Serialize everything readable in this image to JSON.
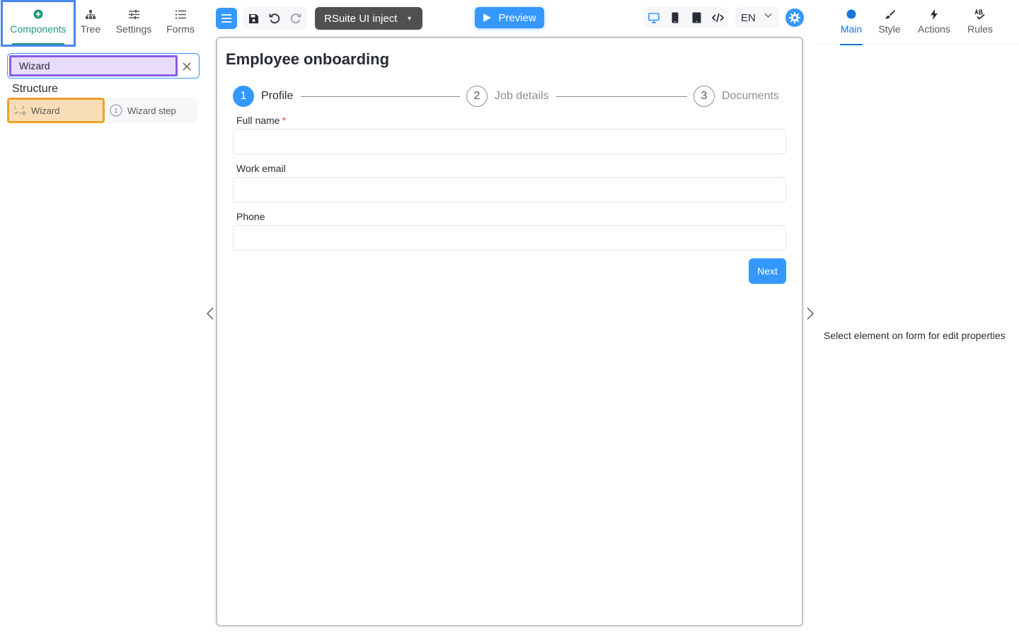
{
  "left_tabs": [
    {
      "label": "Components",
      "icon": "plus-circle-icon",
      "active": true
    },
    {
      "label": "Tree",
      "icon": "sitemap-icon"
    },
    {
      "label": "Settings",
      "icon": "sliders-icon"
    },
    {
      "label": "Forms",
      "icon": "list-icon"
    }
  ],
  "search": {
    "value": "Wizard",
    "placeholder": "Search"
  },
  "palette": {
    "section_title": "Structure",
    "items": [
      {
        "label": "Wizard",
        "icon": "wizard-icon"
      },
      {
        "label": "Wizard step",
        "icon": "step-number-icon",
        "icon_text": "1"
      }
    ]
  },
  "toolbar": {
    "theme": "RSuite UI inject",
    "preview_label": "Preview",
    "language": "EN"
  },
  "form": {
    "title": "Employee onboarding",
    "steps": [
      {
        "number": "1",
        "label": "Profile",
        "active": true
      },
      {
        "number": "2",
        "label": "Job details"
      },
      {
        "number": "3",
        "label": "Documents"
      }
    ],
    "fields": [
      {
        "label": "Full name",
        "required": true,
        "required_mark": "*",
        "value": ""
      },
      {
        "label": "Work email",
        "value": ""
      },
      {
        "label": "Phone",
        "value": ""
      }
    ],
    "next_label": "Next"
  },
  "right_tabs": [
    {
      "label": "Main",
      "icon": "circle-icon",
      "active": true
    },
    {
      "label": "Style",
      "icon": "brush-icon"
    },
    {
      "label": "Actions",
      "icon": "bolt-icon"
    },
    {
      "label": "Rules",
      "icon": "ab-check-icon"
    }
  ],
  "properties": {
    "empty_message": "Select element on form for edit properties"
  },
  "colors": {
    "accent": "#3498ff",
    "components_tab": "#1e9a7a",
    "main_tab": "#1675e0",
    "search_highlight": "#8a5ce6",
    "wizard_highlight": "#f0a02a",
    "tab_highlight": "#4a86e8"
  }
}
